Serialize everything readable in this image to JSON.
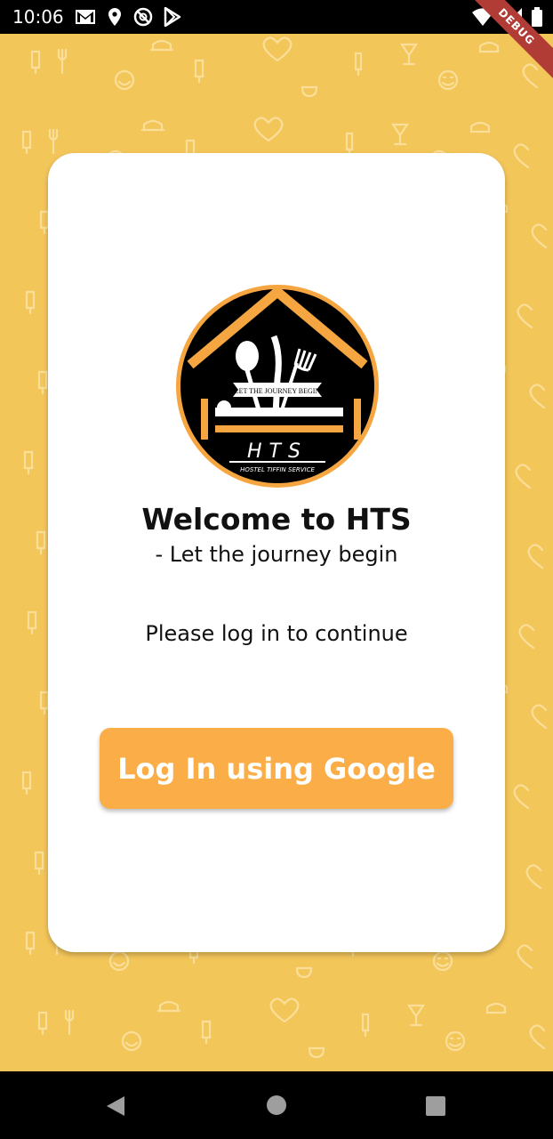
{
  "status_bar": {
    "time": "10:06",
    "debug_label": "DEBUG",
    "left_icons": [
      "gmail-icon",
      "location-icon",
      "do-not-disturb-icon",
      "play-store-icon"
    ],
    "right_icons": [
      "wifi-icon",
      "signal-icon",
      "battery-icon"
    ]
  },
  "logo": {
    "banner_text": "LET THE JOURNEY BEGIN",
    "brand": "HTS",
    "tagline": "HOSTEL TIFFIN SERVICE"
  },
  "card": {
    "title": "Welcome to HTS",
    "subtitle": "- Let the journey begin",
    "prompt": "Please log in to continue",
    "login_button_label": "Log In using Google"
  },
  "nav_bar": {
    "buttons": [
      "back-icon",
      "home-icon",
      "recent-apps-icon"
    ]
  },
  "colors": {
    "background": "#F3C65A",
    "accent": "#FBAE48",
    "card": "#FFFFFF",
    "debug_ribbon": "#B13B35"
  }
}
